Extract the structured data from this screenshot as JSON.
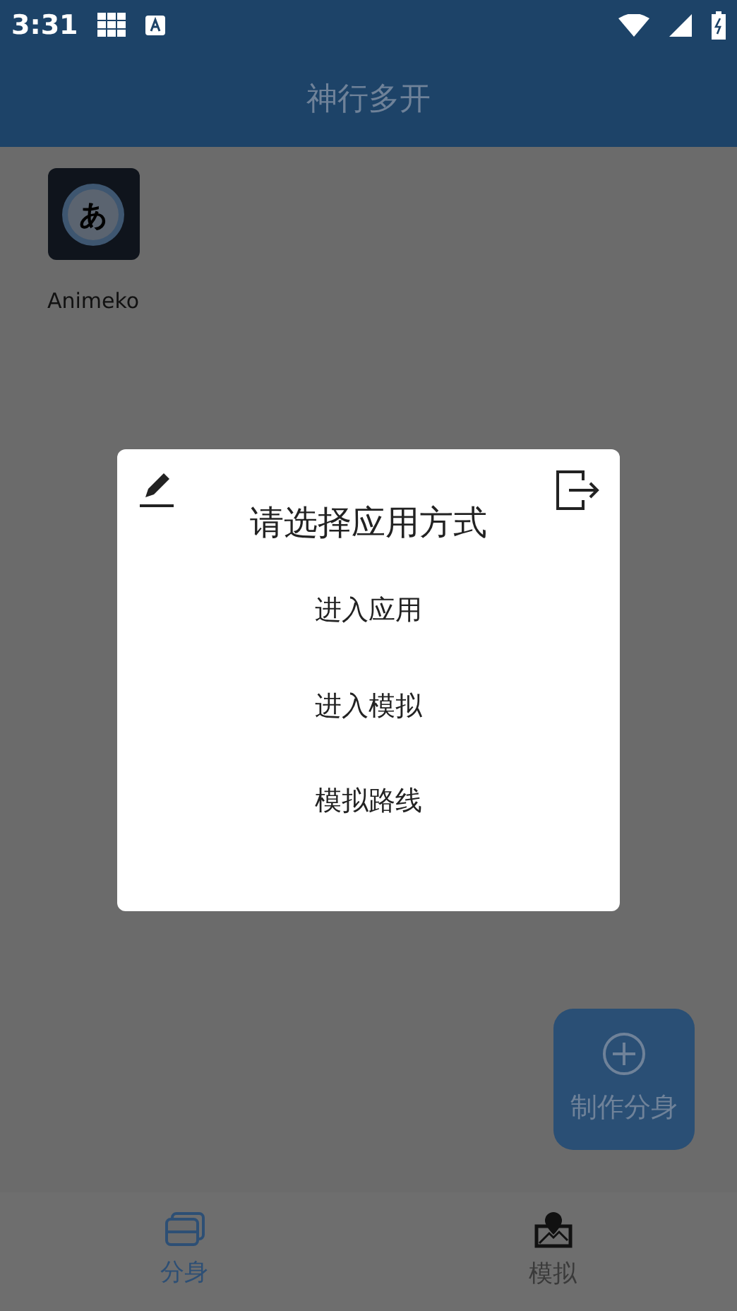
{
  "status_bar": {
    "time": "3:31"
  },
  "app_bar": {
    "title": "神行多开"
  },
  "apps": [
    {
      "name": "Animeko",
      "icon_glyph": "あ"
    }
  ],
  "dialog": {
    "title": "请选择应用方式",
    "options": [
      "进入应用",
      "进入模拟",
      "模拟路线"
    ]
  },
  "fab": {
    "label": "制作分身"
  },
  "bottom_nav": [
    {
      "label": "分身",
      "kind": "clone",
      "selected": true
    },
    {
      "label": "模拟",
      "kind": "map",
      "selected": false
    }
  ]
}
